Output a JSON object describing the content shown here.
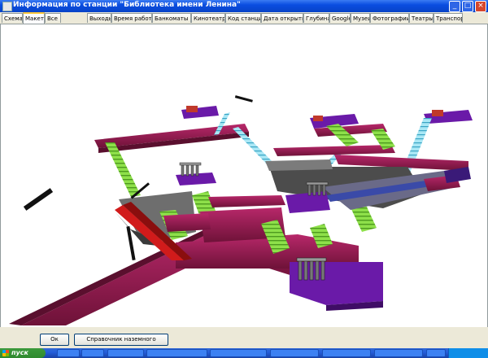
{
  "window": {
    "title": "Информация по станции \"Библиотека имени Ленина\""
  },
  "tabs": [
    {
      "label": "Схема",
      "active": false
    },
    {
      "label": "Макет",
      "active": true
    },
    {
      "label": "Все",
      "active": false
    },
    {
      "label": "Выходы",
      "active": false
    },
    {
      "label": "Время работы",
      "active": false
    },
    {
      "label": "Банкоматы Сбербанка",
      "active": false
    },
    {
      "label": "Кинотеатры",
      "active": false
    },
    {
      "label": "Код станции",
      "active": false
    },
    {
      "label": "Дата открытия",
      "active": false
    },
    {
      "label": "Глубина",
      "active": false
    },
    {
      "label": "Google",
      "active": false
    },
    {
      "label": "Музеи",
      "active": false
    },
    {
      "label": "Фотографии",
      "active": false
    },
    {
      "label": "Театры",
      "active": false
    },
    {
      "label": "Транспорт",
      "active": false
    }
  ],
  "buttons": {
    "ok": "Ок",
    "transport": "Справочник наземного транспорта"
  },
  "colors": {
    "corridor": "#8b1a4a",
    "stairs": "#8ee04a",
    "platform": "#4a4a4a",
    "hall": "#6a1aa8",
    "escalator": "#7fd6e8"
  },
  "icons": {
    "app": "app-icon",
    "minimize": "minimize-icon",
    "maximize": "maximize-icon",
    "close": "close-icon",
    "start": "windows-logo-icon"
  },
  "taskbar": {
    "start_label": "пуск"
  }
}
